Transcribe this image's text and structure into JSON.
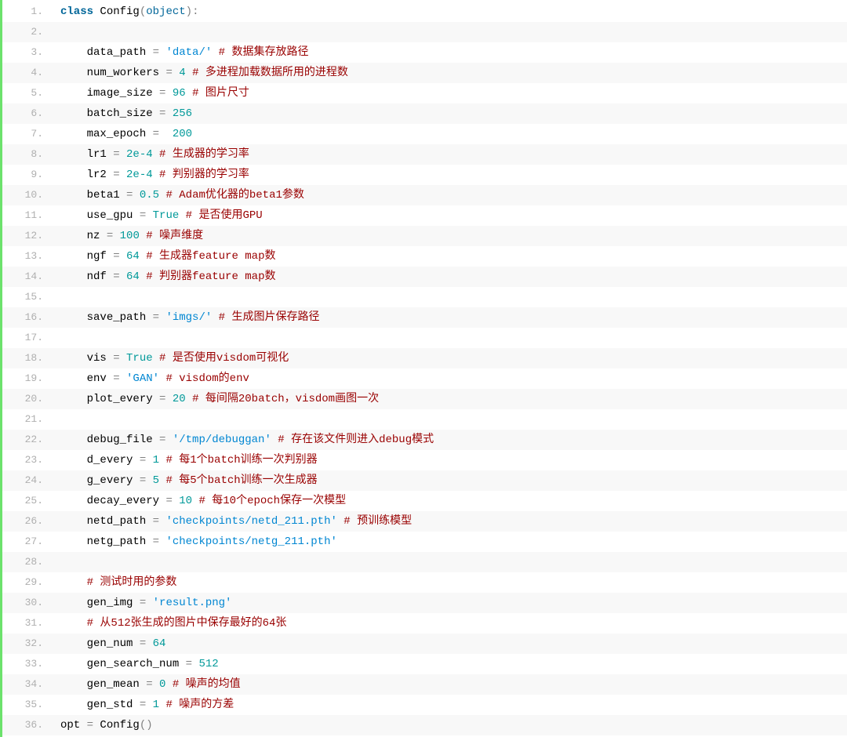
{
  "lines": [
    {
      "n": "1.",
      "tokens": [
        [
          "k",
          "class "
        ],
        [
          "id",
          "Config"
        ],
        [
          "p",
          "("
        ],
        [
          "cn",
          "object"
        ],
        [
          "p",
          "):"
        ]
      ]
    },
    {
      "n": "2.",
      "tokens": []
    },
    {
      "n": "3.",
      "tokens": [
        [
          "p",
          "    "
        ],
        [
          "id",
          "data_path "
        ],
        [
          "op",
          "= "
        ],
        [
          "s",
          "'data/'"
        ],
        [
          "p",
          " "
        ],
        [
          "c",
          "# 数据集存放路径"
        ]
      ]
    },
    {
      "n": "4.",
      "tokens": [
        [
          "p",
          "    "
        ],
        [
          "id",
          "num_workers "
        ],
        [
          "op",
          "= "
        ],
        [
          "n",
          "4"
        ],
        [
          "p",
          " "
        ],
        [
          "c",
          "# 多进程加载数据所用的进程数"
        ]
      ]
    },
    {
      "n": "5.",
      "tokens": [
        [
          "p",
          "    "
        ],
        [
          "id",
          "image_size "
        ],
        [
          "op",
          "= "
        ],
        [
          "n",
          "96"
        ],
        [
          "p",
          " "
        ],
        [
          "c",
          "# 图片尺寸"
        ]
      ]
    },
    {
      "n": "6.",
      "tokens": [
        [
          "p",
          "    "
        ],
        [
          "id",
          "batch_size "
        ],
        [
          "op",
          "= "
        ],
        [
          "n",
          "256"
        ]
      ]
    },
    {
      "n": "7.",
      "tokens": [
        [
          "p",
          "    "
        ],
        [
          "id",
          "max_epoch "
        ],
        [
          "op",
          "=  "
        ],
        [
          "n",
          "200"
        ]
      ]
    },
    {
      "n": "8.",
      "tokens": [
        [
          "p",
          "    "
        ],
        [
          "id",
          "lr1 "
        ],
        [
          "op",
          "= "
        ],
        [
          "n",
          "2e-4"
        ],
        [
          "p",
          " "
        ],
        [
          "c",
          "# 生成器的学习率"
        ]
      ]
    },
    {
      "n": "9.",
      "tokens": [
        [
          "p",
          "    "
        ],
        [
          "id",
          "lr2 "
        ],
        [
          "op",
          "= "
        ],
        [
          "n",
          "2e-4"
        ],
        [
          "p",
          " "
        ],
        [
          "c",
          "# 判别器的学习率"
        ]
      ]
    },
    {
      "n": "10.",
      "tokens": [
        [
          "p",
          "    "
        ],
        [
          "id",
          "beta1 "
        ],
        [
          "op",
          "= "
        ],
        [
          "n",
          "0.5"
        ],
        [
          "p",
          " "
        ],
        [
          "c",
          "# Adam优化器的beta1参数"
        ]
      ]
    },
    {
      "n": "11.",
      "tokens": [
        [
          "p",
          "    "
        ],
        [
          "id",
          "use_gpu "
        ],
        [
          "op",
          "= "
        ],
        [
          "n",
          "True"
        ],
        [
          "p",
          " "
        ],
        [
          "c",
          "# 是否使用GPU"
        ]
      ]
    },
    {
      "n": "12.",
      "tokens": [
        [
          "p",
          "    "
        ],
        [
          "id",
          "nz "
        ],
        [
          "op",
          "= "
        ],
        [
          "n",
          "100"
        ],
        [
          "p",
          " "
        ],
        [
          "c",
          "# 噪声维度"
        ]
      ]
    },
    {
      "n": "13.",
      "tokens": [
        [
          "p",
          "    "
        ],
        [
          "id",
          "ngf "
        ],
        [
          "op",
          "= "
        ],
        [
          "n",
          "64"
        ],
        [
          "p",
          " "
        ],
        [
          "c",
          "# 生成器feature map数"
        ]
      ]
    },
    {
      "n": "14.",
      "tokens": [
        [
          "p",
          "    "
        ],
        [
          "id",
          "ndf "
        ],
        [
          "op",
          "= "
        ],
        [
          "n",
          "64"
        ],
        [
          "p",
          " "
        ],
        [
          "c",
          "# 判别器feature map数"
        ]
      ]
    },
    {
      "n": "15.",
      "tokens": []
    },
    {
      "n": "16.",
      "tokens": [
        [
          "p",
          "    "
        ],
        [
          "id",
          "save_path "
        ],
        [
          "op",
          "= "
        ],
        [
          "s",
          "'imgs/'"
        ],
        [
          "p",
          " "
        ],
        [
          "c",
          "# 生成图片保存路径"
        ]
      ]
    },
    {
      "n": "17.",
      "tokens": []
    },
    {
      "n": "18.",
      "tokens": [
        [
          "p",
          "    "
        ],
        [
          "id",
          "vis "
        ],
        [
          "op",
          "= "
        ],
        [
          "n",
          "True"
        ],
        [
          "p",
          " "
        ],
        [
          "c",
          "# 是否使用visdom可视化"
        ]
      ]
    },
    {
      "n": "19.",
      "tokens": [
        [
          "p",
          "    "
        ],
        [
          "id",
          "env "
        ],
        [
          "op",
          "= "
        ],
        [
          "s",
          "'GAN'"
        ],
        [
          "p",
          " "
        ],
        [
          "c",
          "# visdom的env"
        ]
      ]
    },
    {
      "n": "20.",
      "tokens": [
        [
          "p",
          "    "
        ],
        [
          "id",
          "plot_every "
        ],
        [
          "op",
          "= "
        ],
        [
          "n",
          "20"
        ],
        [
          "p",
          " "
        ],
        [
          "c",
          "# 每间隔20batch，visdom画图一次"
        ]
      ]
    },
    {
      "n": "21.",
      "tokens": []
    },
    {
      "n": "22.",
      "tokens": [
        [
          "p",
          "    "
        ],
        [
          "id",
          "debug_file "
        ],
        [
          "op",
          "= "
        ],
        [
          "s",
          "'/tmp/debuggan'"
        ],
        [
          "p",
          " "
        ],
        [
          "c",
          "# 存在该文件则进入debug模式"
        ]
      ]
    },
    {
      "n": "23.",
      "tokens": [
        [
          "p",
          "    "
        ],
        [
          "id",
          "d_every "
        ],
        [
          "op",
          "= "
        ],
        [
          "n",
          "1"
        ],
        [
          "p",
          " "
        ],
        [
          "c",
          "# 每1个batch训练一次判别器"
        ]
      ]
    },
    {
      "n": "24.",
      "tokens": [
        [
          "p",
          "    "
        ],
        [
          "id",
          "g_every "
        ],
        [
          "op",
          "= "
        ],
        [
          "n",
          "5"
        ],
        [
          "p",
          " "
        ],
        [
          "c",
          "# 每5个batch训练一次生成器"
        ]
      ]
    },
    {
      "n": "25.",
      "tokens": [
        [
          "p",
          "    "
        ],
        [
          "id",
          "decay_every "
        ],
        [
          "op",
          "= "
        ],
        [
          "n",
          "10"
        ],
        [
          "p",
          " "
        ],
        [
          "c",
          "# 每10个epoch保存一次模型"
        ]
      ]
    },
    {
      "n": "26.",
      "tokens": [
        [
          "p",
          "    "
        ],
        [
          "id",
          "netd_path "
        ],
        [
          "op",
          "= "
        ],
        [
          "s",
          "'checkpoints/netd_211.pth'"
        ],
        [
          "p",
          " "
        ],
        [
          "c",
          "# 预训练模型"
        ]
      ]
    },
    {
      "n": "27.",
      "tokens": [
        [
          "p",
          "    "
        ],
        [
          "id",
          "netg_path "
        ],
        [
          "op",
          "= "
        ],
        [
          "s",
          "'checkpoints/netg_211.pth'"
        ]
      ]
    },
    {
      "n": "28.",
      "tokens": []
    },
    {
      "n": "29.",
      "tokens": [
        [
          "p",
          "    "
        ],
        [
          "c",
          "# 测试时用的参数"
        ]
      ]
    },
    {
      "n": "30.",
      "tokens": [
        [
          "p",
          "    "
        ],
        [
          "id",
          "gen_img "
        ],
        [
          "op",
          "= "
        ],
        [
          "s",
          "'result.png'"
        ]
      ]
    },
    {
      "n": "31.",
      "tokens": [
        [
          "p",
          "    "
        ],
        [
          "c",
          "# 从512张生成的图片中保存最好的64张"
        ]
      ]
    },
    {
      "n": "32.",
      "tokens": [
        [
          "p",
          "    "
        ],
        [
          "id",
          "gen_num "
        ],
        [
          "op",
          "= "
        ],
        [
          "n",
          "64"
        ]
      ]
    },
    {
      "n": "33.",
      "tokens": [
        [
          "p",
          "    "
        ],
        [
          "id",
          "gen_search_num "
        ],
        [
          "op",
          "= "
        ],
        [
          "n",
          "512"
        ]
      ]
    },
    {
      "n": "34.",
      "tokens": [
        [
          "p",
          "    "
        ],
        [
          "id",
          "gen_mean "
        ],
        [
          "op",
          "= "
        ],
        [
          "n",
          "0"
        ],
        [
          "p",
          " "
        ],
        [
          "c",
          "# 噪声的均值"
        ]
      ]
    },
    {
      "n": "35.",
      "tokens": [
        [
          "p",
          "    "
        ],
        [
          "id",
          "gen_std "
        ],
        [
          "op",
          "= "
        ],
        [
          "n",
          "1"
        ],
        [
          "p",
          " "
        ],
        [
          "c",
          "# 噪声的方差"
        ]
      ]
    },
    {
      "n": "36.",
      "tokens": [
        [
          "id",
          "opt "
        ],
        [
          "op",
          "= "
        ],
        [
          "id",
          "Config"
        ],
        [
          "p",
          "()"
        ]
      ]
    }
  ]
}
